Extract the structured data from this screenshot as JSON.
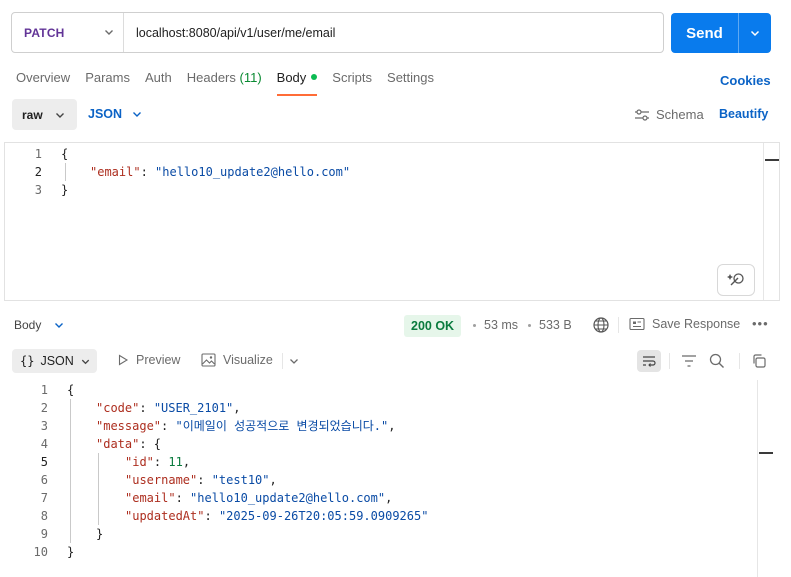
{
  "request": {
    "method": "PATCH",
    "url": "localhost:8080/api/v1/user/me/email",
    "send_label": "Send"
  },
  "tabs": [
    {
      "label": "Overview"
    },
    {
      "label": "Params"
    },
    {
      "label": "Auth"
    },
    {
      "label": "Headers",
      "count": "(11)"
    },
    {
      "label": "Body",
      "active": true
    },
    {
      "label": "Scripts"
    },
    {
      "label": "Settings"
    }
  ],
  "cookies_label": "Cookies",
  "body_mode": {
    "type": "raw",
    "format": "JSON",
    "schema_label": "Schema",
    "beautify_label": "Beautify"
  },
  "request_body": {
    "line_numbers": [
      "1",
      "2",
      "3"
    ],
    "open_brace": "{",
    "email_key": "\"email\"",
    "email_value": "\"hello10_update2@hello.com\"",
    "close_brace": "}"
  },
  "response": {
    "view_label": "Body",
    "status": "200 OK",
    "time": "53 ms",
    "size": "533 B",
    "save_label": "Save Response",
    "more_label": "•••",
    "format_label": "JSON",
    "format_braces": "{}",
    "preview_label": "Preview",
    "visualize_label": "Visualize",
    "line_numbers": [
      "1",
      "2",
      "3",
      "4",
      "5",
      "6",
      "7",
      "8",
      "9",
      "10"
    ],
    "body": {
      "code_key": "\"code\"",
      "code_value": "\"USER_2101\"",
      "message_key": "\"message\"",
      "message_value": "\"이메일이 성공적으로 변경되었습니다.\"",
      "data_key": "\"data\"",
      "id_key": "\"id\"",
      "id_value": "11",
      "username_key": "\"username\"",
      "username_value": "\"test10\"",
      "email_key": "\"email\"",
      "email_value": "\"hello10_update2@hello.com\"",
      "updated_key": "\"updatedAt\"",
      "updated_value": "\"2025-09-26T20:05:59.0909265\""
    }
  },
  "colors": {
    "method": "#623497",
    "send": "#097bed",
    "link": "#0b63c6",
    "status_ok": "#0a7b3e",
    "json_key": "#ad2e1f",
    "json_string": "#0a4ba5",
    "active_tab_underline": "#ff6c37"
  }
}
